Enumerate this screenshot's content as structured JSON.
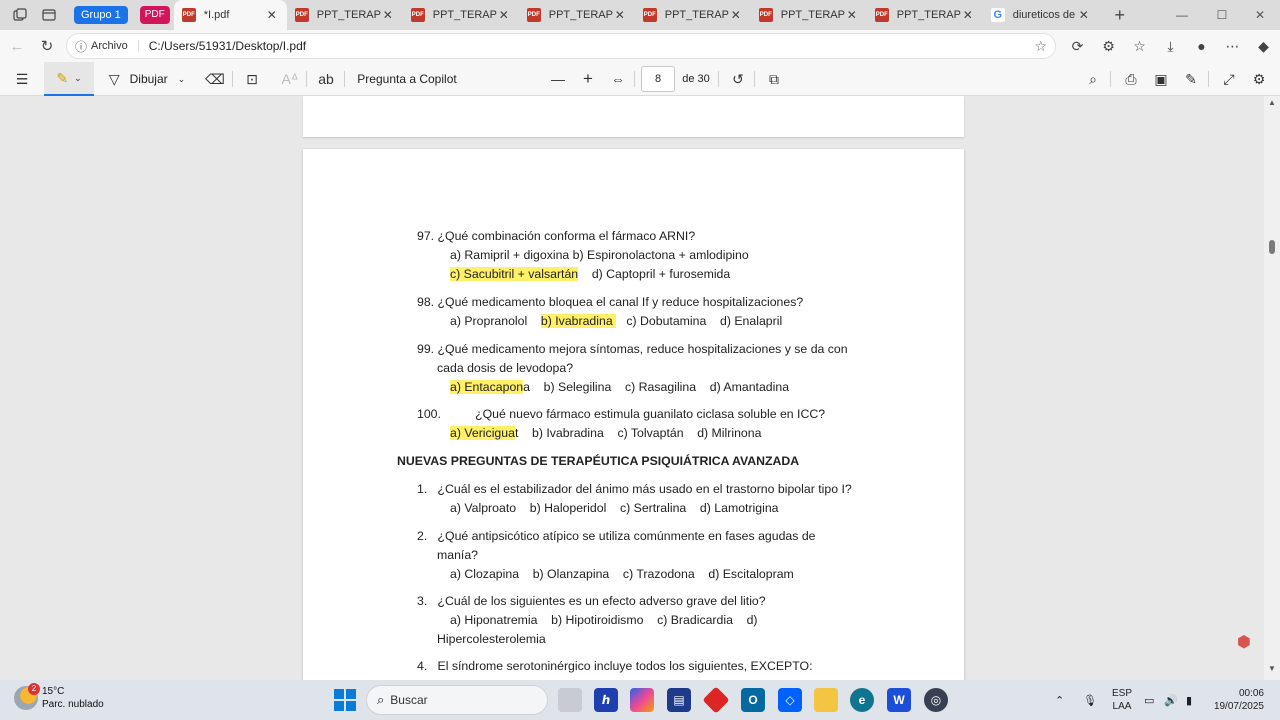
{
  "tabstrip": {
    "group_label": "Grupo 1",
    "pdf_chip": "PDF",
    "tabs": [
      {
        "title": "*I.pdf",
        "icon": "pdf-icon",
        "active": true
      },
      {
        "title": "PPT_TERAPEUTICA",
        "icon": "pdf-icon"
      },
      {
        "title": "PPT_TERAPEUTICA",
        "icon": "pdf-icon"
      },
      {
        "title": "PPT_TERAPEUTICA",
        "icon": "pdf-icon"
      },
      {
        "title": "PPT_TERAPEUTICA",
        "icon": "pdf-icon"
      },
      {
        "title": "PPT_TERAPEUTICA",
        "icon": "pdf-icon"
      },
      {
        "title": "PPT_TERAPEUTICA",
        "icon": "pdf-icon"
      },
      {
        "title": "diureticos de asa",
        "icon": "google-icon"
      }
    ],
    "new_tab": "+"
  },
  "addressbar": {
    "info_label": "Archivo",
    "url": "C:/Users/51931/Desktop/I.pdf"
  },
  "pdf_toolbar": {
    "draw_label": "Dibujar",
    "copilot_label": "Pregunta a Copilot",
    "page_current": "8",
    "page_total": "de 30"
  },
  "document": {
    "lines": [
      {
        "text": "97. ¿Qué combinación conforma el fármaco ARNI?"
      },
      {
        "text": "a) Ramipril + digoxina    b) Espironolactona + amlodipino"
      },
      {
        "hl": "c) Sacubitril + valsartán",
        "rest": "    d) Captopril + furosemida"
      },
      {
        "text": "98. ¿Qué medicamento bloquea el canal If y reduce hospitalizaciones?"
      },
      {
        "pre": "a) Propranolol    ",
        "hl": "b) Ivabradina ",
        "rest": "   c) Dobutamina    d) Enalapril"
      },
      {
        "text": "99. ¿Qué medicamento mejora síntomas, reduce hospitalizaciones y se da con"
      },
      {
        "text": "cada dosis de levodopa?"
      },
      {
        "hl": "a) Entacapon",
        "rest": "a    b) Selegilina    c) Rasagilina    d) Amantadina"
      },
      {
        "text": "100.          ¿Qué nuevo fármaco estimula guanilato ciclasa soluble en ICC?"
      },
      {
        "hl": "a) Vericigua",
        "rest": "t    b) Ivabradina    c) Tolvaptán    d) Milrinona"
      },
      {
        "text": "NUEVAS PREGUNTAS DE TERAPÉUTICA PSIQUIÁTRICA AVANZADA"
      },
      {
        "text": "1.   ¿Cuál es el estabilizador del ánimo más usado en el trastorno bipolar tipo I?"
      },
      {
        "text": "a) Valproato    b) Haloperidol    c) Sertralina    d) Lamotrigina"
      },
      {
        "text": "2.   ¿Qué antipsicótico atípico se utiliza comúnmente en fases agudas de"
      },
      {
        "text": "manía?"
      },
      {
        "text": "a) Clozapina    b) Olanzapina    c) Trazodona    d) Escitalopram"
      },
      {
        "text": "3.   ¿Cuál de los siguientes es un efecto adverso grave del litio?"
      },
      {
        "text": "a) Hiponatremia    b) Hipotiroidismo    c) Bradicardia    d)"
      },
      {
        "text": "Hipercolesterolemia"
      },
      {
        "text": "4.   El síndrome serotoninérgico incluye todos los siguientes, EXCEPTO:"
      }
    ]
  },
  "taskbar": {
    "weather_temp": "15°C",
    "weather_desc": "Parc. nublado",
    "weather_badge": "2",
    "search_label": "Buscar",
    "lang_top": "ESP",
    "lang_bottom": "LAA",
    "time": "00:06",
    "date": "19/07/2025"
  },
  "colors": {
    "highlight": "#fff067",
    "accent": "#1a73e8",
    "pdf_chip": "#d3165b"
  }
}
